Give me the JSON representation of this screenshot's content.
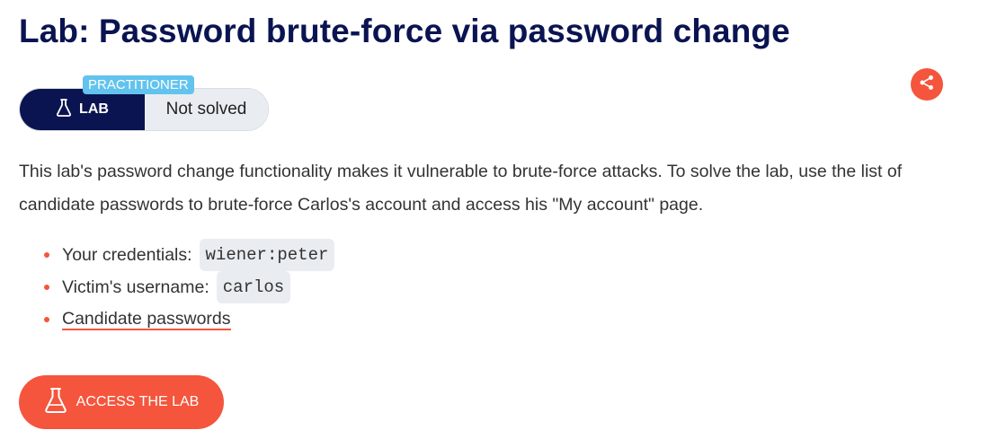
{
  "header": {
    "title": "Lab: Password brute-force via password change"
  },
  "badge": {
    "level": "PRACTITIONER",
    "lab_label": "LAB",
    "status": "Not solved"
  },
  "share": {
    "icon": "share-icon",
    "color": "#f4553c"
  },
  "description": "This lab's password change functionality makes it vulnerable to brute-force attacks. To solve the lab, use the list of candidate passwords to brute-force Carlos's account and access his \"My account\" page.",
  "info": {
    "credentials_label": "Your credentials:",
    "credentials_value": "wiener:peter",
    "victim_label": "Victim's username:",
    "victim_value": "carlos",
    "candidate_link": "Candidate passwords"
  },
  "access_button": {
    "label": "ACCESS THE LAB",
    "icon": "flask-icon"
  },
  "colors": {
    "navy": "#0a1451",
    "accent": "#f4553c",
    "practitioner": "#62c3ee",
    "badge_bg": "#e9edf1"
  }
}
